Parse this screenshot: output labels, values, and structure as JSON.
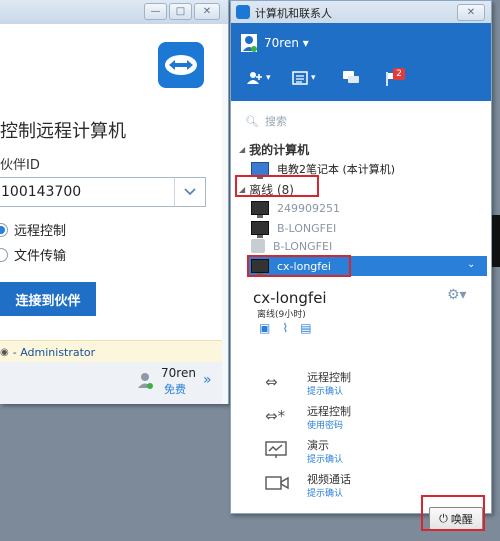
{
  "main_window": {
    "remote_title": "控制远程计算机",
    "partner_id_label": "伙伴ID",
    "partner_id_value": "100143700",
    "radio_remote_control": "远程控制",
    "radio_file_transfer": "文件传输",
    "connect_button": "连接到伙伴",
    "admin_text": "- Administrator",
    "account_name": "70ren",
    "account_plan": "免费",
    "more_icon": "»"
  },
  "contacts_window": {
    "title": "计算机和联系人",
    "user_name": "70ren",
    "notification_count": "2",
    "search_placeholder": "搜索",
    "my_computers_header": "我的计算机",
    "my_computer_item": "电教2笔记本 (本计算机)",
    "offline_header": "离线 (8)",
    "offline_items": [
      "249909251",
      "B-LONGFEI",
      "B-LONGFEI",
      "cx-longfei"
    ],
    "detail": {
      "name": "cx-longfei",
      "status": "离线(9小时)"
    },
    "actions": [
      {
        "title": "远程控制",
        "sub": "提示确认"
      },
      {
        "title": "远程控制",
        "sub": "使用密码"
      },
      {
        "title": "演示",
        "sub": "提示确认"
      },
      {
        "title": "视频通话",
        "sub": "提示确认"
      }
    ],
    "wake_button": "唤醒"
  },
  "colors": {
    "accent_blue": "#1f6fc7",
    "highlight_red": "#d8262f"
  }
}
